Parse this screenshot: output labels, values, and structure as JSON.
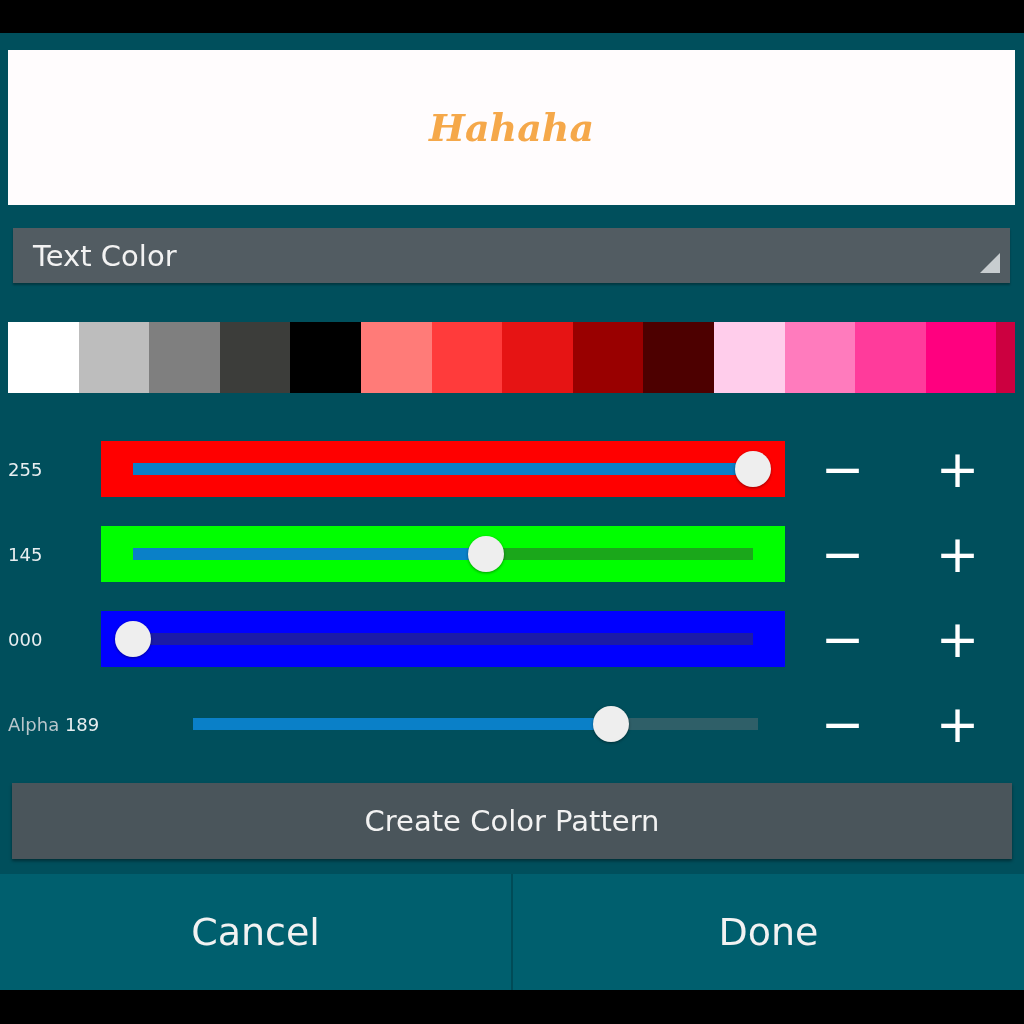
{
  "preview": {
    "text": "Hahaha"
  },
  "dropdown": {
    "value": "Text Color"
  },
  "swatches": [
    {
      "color": "#ffffff"
    },
    {
      "color": "#bdbdbd"
    },
    {
      "color": "#7f7f7f"
    },
    {
      "color": "#3c3d3a"
    },
    {
      "color": "#000000"
    },
    {
      "color": "#ff7b78"
    },
    {
      "color": "#ff3b3b"
    },
    {
      "color": "#e61414"
    },
    {
      "color": "#990000"
    },
    {
      "color": "#4d0000"
    },
    {
      "color": "#ffcdeb"
    },
    {
      "color": "#ff7bbd"
    },
    {
      "color": "#ff3b9b"
    },
    {
      "color": "#ff007f"
    },
    {
      "color": "#cc0040"
    }
  ],
  "sliders": [
    {
      "kind": "channel",
      "value": "255",
      "color": "#ff0000",
      "level": 1.0,
      "minus": "−",
      "plus": "+"
    },
    {
      "kind": "channel",
      "value": "145",
      "color": "#00ff00",
      "level": 0.57,
      "minus": "−",
      "plus": "+"
    },
    {
      "kind": "channel",
      "value": "000",
      "color": "#0000ff",
      "level": 0.0,
      "minus": "−",
      "plus": "+"
    },
    {
      "kind": "alpha",
      "label": "Alpha",
      "value": "189",
      "level": 0.74,
      "minus": "−",
      "plus": "+"
    }
  ],
  "pattern_button": "Create Color Pattern",
  "buttons": [
    "Cancel",
    "Done"
  ]
}
